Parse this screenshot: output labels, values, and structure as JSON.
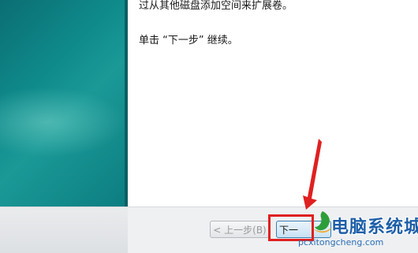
{
  "content": {
    "line1": "过从其他磁盘添加空间来扩展卷。",
    "line2": "单击 “下一步” 继续。"
  },
  "buttons": {
    "prev_label": "< 上一步(B)",
    "next_label": "下一"
  },
  "watermark": {
    "title": "电脑系统城",
    "url": "pcxitongcheng.com"
  },
  "colors": {
    "banner": "#0f8a8b",
    "highlight": "#e02020",
    "watermark": "#1e5fa8"
  }
}
